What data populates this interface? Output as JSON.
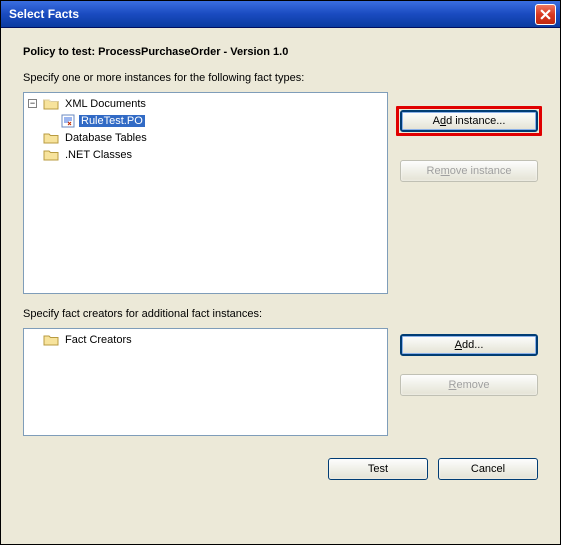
{
  "window": {
    "title": "Select Facts"
  },
  "policy": {
    "label": "Policy to test: ProcessPurchaseOrder - Version 1.0"
  },
  "section1": {
    "label": "Specify one or more instances for the following fact types:",
    "tree": {
      "xml_docs": "XML Documents",
      "rule_test": "RuleTest.PO",
      "db_tables": "Database Tables",
      "net_classes": ".NET Classes"
    },
    "add_btn_pre": "A",
    "add_btn_u": "d",
    "add_btn_post": "d instance...",
    "remove_btn_pre": "Re",
    "remove_btn_u": "m",
    "remove_btn_post": "ove instance"
  },
  "section2": {
    "label": "Specify fact creators for additional fact instances:",
    "tree": {
      "fact_creators": "Fact Creators"
    },
    "add_btn_pre": "",
    "add_btn_u": "A",
    "add_btn_post": "dd...",
    "remove_btn_pre": "",
    "remove_btn_u": "R",
    "remove_btn_post": "emove"
  },
  "footer": {
    "test": "Test",
    "cancel": "Cancel"
  }
}
